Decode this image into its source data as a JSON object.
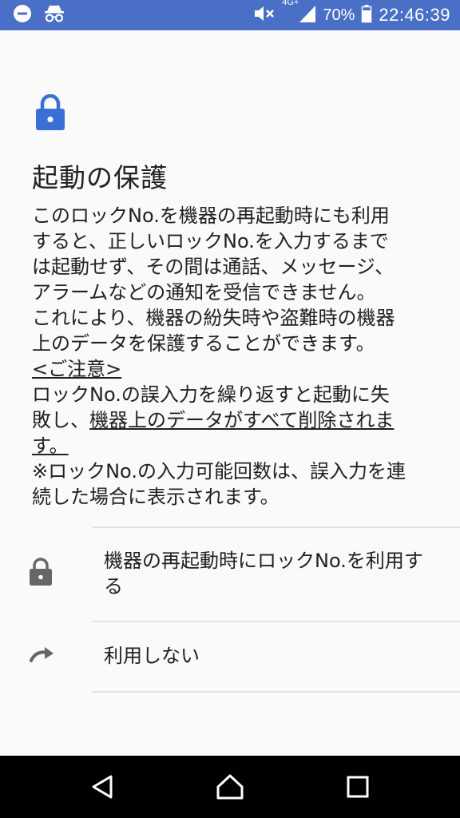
{
  "status_bar": {
    "network": "4G+",
    "battery": "70%",
    "time": "22:46:39",
    "icons": [
      "dnd-icon",
      "incognito-icon",
      "mute-icon",
      "signal-icon",
      "battery-icon"
    ]
  },
  "colors": {
    "status_bar": "#4a6fc7",
    "accent": "#3b6fd8",
    "background": "#fafafa",
    "nav_bar": "#000000"
  },
  "page": {
    "title": "起動の保護",
    "desc_lines": [
      "このロックNo.を機器の再起動時にも利用",
      "すると、正しいロックNo.を入力するまで",
      "は起動せず、その間は通話、メッセージ、",
      "アラームなどの通知を受信できません。",
      "これにより、機器の紛失時や盗難時の機器",
      "上のデータを保護することができます。"
    ],
    "notice_heading": "<ご注意>",
    "warning_line1": "ロックNo.の誤入力を繰り返すと起動に失",
    "warning_line2_plain": "敗し、",
    "warning_line2_underlined": "機器上のデータがすべて削除されま",
    "warning_line3_underlined": "す。",
    "note_line1": "※ロックNo.の入力可能回数は、誤入力を連",
    "note_line2": "続した場合に表示されます。"
  },
  "options": {
    "use_label": "機器の再起動時にロックNo.を利用する",
    "skip_label": "利用しない"
  },
  "nav": {
    "icons": [
      "back-icon",
      "home-icon",
      "recents-icon"
    ]
  }
}
